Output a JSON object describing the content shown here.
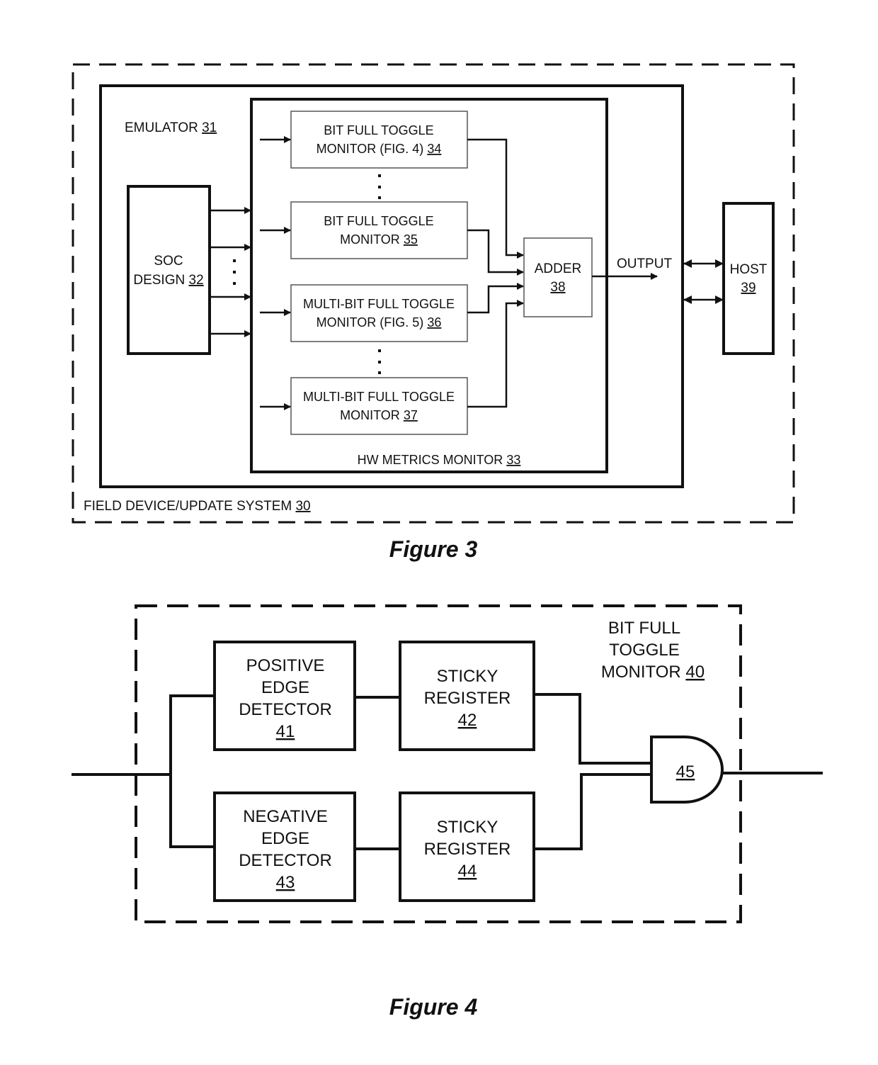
{
  "figure3": {
    "caption": "Figure 3",
    "system": {
      "label": "FIELD DEVICE/UPDATE SYSTEM",
      "ref": "30"
    },
    "emulator": {
      "label": "EMULATOR",
      "ref": "31"
    },
    "soc": {
      "line1": "SOC",
      "line2": "DESIGN",
      "ref": "32"
    },
    "hw_monitor": {
      "label": "HW METRICS MONITOR",
      "ref": "33"
    },
    "monitors": [
      {
        "line1": "BIT FULL TOGGLE",
        "line2": "MONITOR (FIG. 4)",
        "ref": "34"
      },
      {
        "line1": "BIT FULL TOGGLE",
        "line2": "MONITOR",
        "ref": "35"
      },
      {
        "line1": "MULTI-BIT FULL TOGGLE",
        "line2": "MONITOR (FIG. 5)",
        "ref": "36"
      },
      {
        "line1": "MULTI-BIT FULL TOGGLE",
        "line2": "MONITOR",
        "ref": "37"
      }
    ],
    "adder": {
      "label": "ADDER",
      "ref": "38"
    },
    "output_label": "OUTPUT",
    "host": {
      "label": "HOST",
      "ref": "39"
    }
  },
  "figure4": {
    "caption": "Figure 4",
    "monitor": {
      "line1": "BIT FULL",
      "line2": "TOGGLE",
      "line3": "MONITOR",
      "ref": "40"
    },
    "pos_detector": {
      "line1": "POSITIVE",
      "line2": "EDGE",
      "line3": "DETECTOR",
      "ref": "41"
    },
    "sticky1": {
      "line1": "STICKY",
      "line2": "REGISTER",
      "ref": "42"
    },
    "neg_detector": {
      "line1": "NEGATIVE",
      "line2": "EDGE",
      "line3": "DETECTOR",
      "ref": "43"
    },
    "sticky2": {
      "line1": "STICKY",
      "line2": "REGISTER",
      "ref": "44"
    },
    "and_gate": {
      "ref": "45"
    }
  }
}
